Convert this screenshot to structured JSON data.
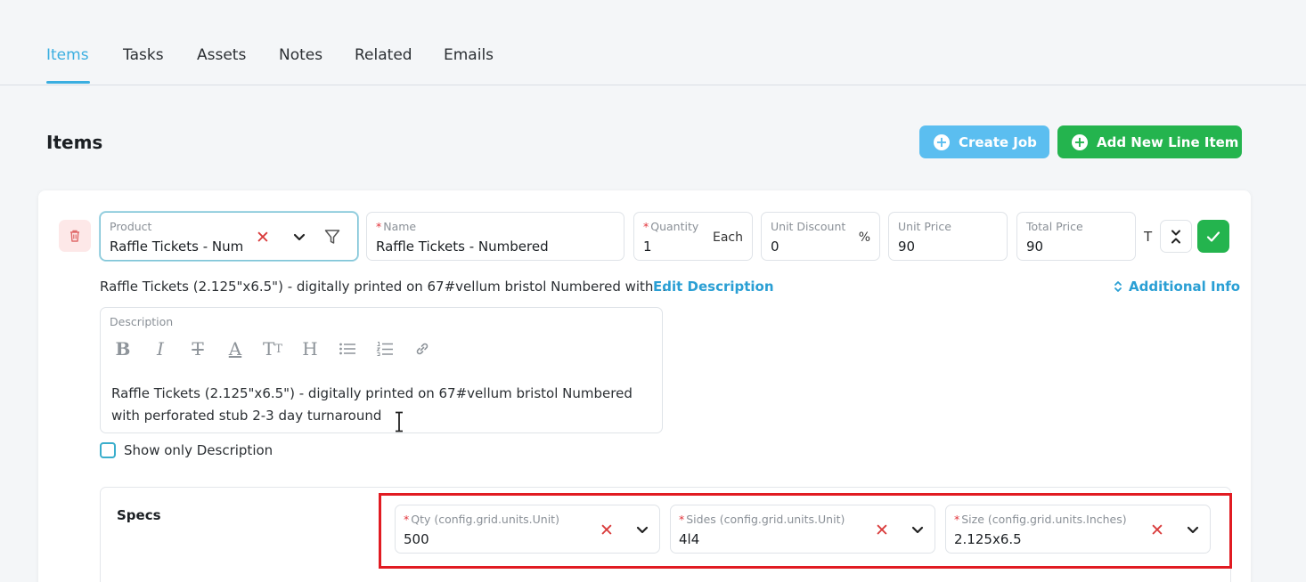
{
  "tabs": [
    {
      "label": "Items",
      "active": true
    },
    {
      "label": "Tasks"
    },
    {
      "label": "Assets"
    },
    {
      "label": "Notes"
    },
    {
      "label": "Related"
    },
    {
      "label": "Emails"
    }
  ],
  "section_title": "Items",
  "buttons": {
    "create_job": "Create Job",
    "add_line_item": "Add New Line Item"
  },
  "line_item": {
    "product": {
      "label": "Product",
      "value": "Raffle Tickets - Num"
    },
    "name": {
      "label": "Name",
      "value": "Raffle Tickets - Numbered"
    },
    "quantity": {
      "label": "Quantity",
      "value": "1",
      "unit": "Each"
    },
    "unit_discount": {
      "label": "Unit Discount",
      "value": "0",
      "unit": "%"
    },
    "unit_price": {
      "label": "Unit Price",
      "value": "90"
    },
    "total_price": {
      "label": "Total Price",
      "value": "90"
    },
    "tax_label": "T",
    "description_summary": "Raffle Tickets (2.125\"x6.5\") - digitally printed on 67#vellum bristol Numbered with...",
    "edit_description": "Edit Description",
    "additional_info": "Additional Info",
    "description": {
      "label": "Description",
      "text": "Raffle Tickets (2.125\"x6.5\") - digitally printed on 67#vellum bristol Numbered with perforated stub 2-3 day turnaround"
    },
    "show_only_description": "Show only Description"
  },
  "specs": {
    "title": "Specs",
    "fields": [
      {
        "label": "Qty (config.grid.units.Unit)",
        "value": "500"
      },
      {
        "label": "Sides (config.grid.units.Unit)",
        "value": "4l4"
      },
      {
        "label": "Size (config.grid.units.Inches)",
        "value": "2.125x6.5"
      }
    ]
  },
  "colors": {
    "accent": "#3aaee0",
    "create_job": "#5bbef0",
    "add_item": "#24b44e",
    "danger": "#d93b3b",
    "highlight": "#e11b22"
  }
}
